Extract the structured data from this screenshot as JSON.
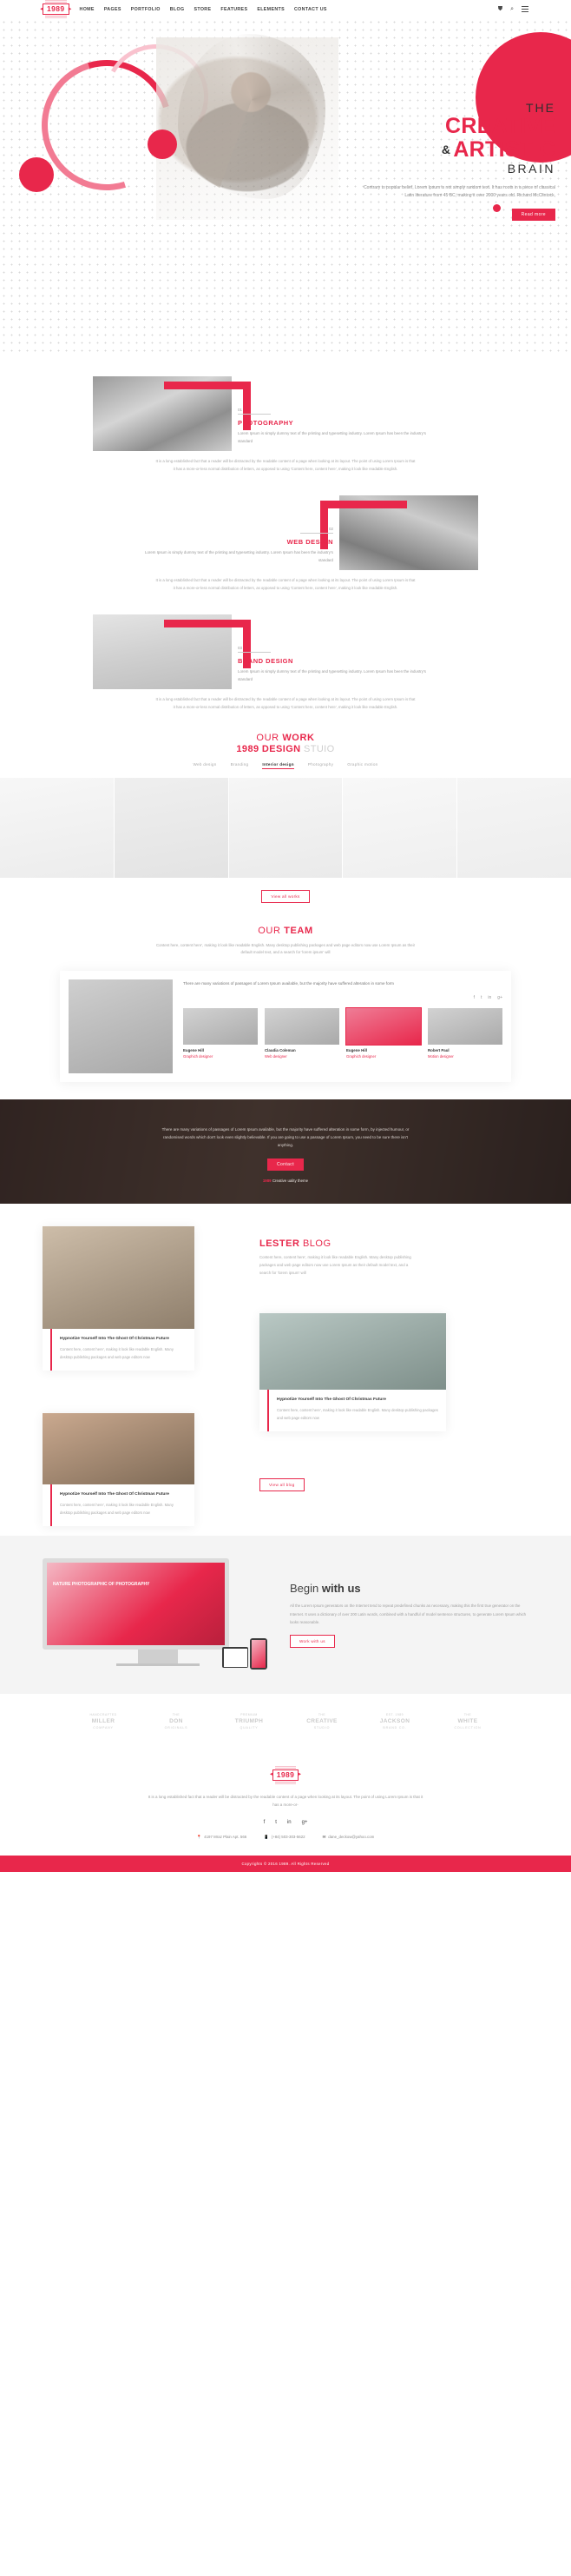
{
  "header": {
    "logo": "1989",
    "nav": [
      {
        "label": "HOME"
      },
      {
        "label": "PAGES"
      },
      {
        "label": "PORTFOLIO"
      },
      {
        "label": "BLOG"
      },
      {
        "label": "STORE"
      },
      {
        "label": "FEATURES"
      },
      {
        "label": "ELEMENTS"
      },
      {
        "label": "CONTACT US"
      }
    ],
    "icons": {
      "cart": "cart-icon",
      "search": "search-icon",
      "menu": "hamburger-icon"
    }
  },
  "hero": {
    "eyebrow": "THE",
    "line1": "CREATIVE",
    "amp": "&",
    "line2": "ARTISTIC",
    "line3": "BRAIN",
    "paragraph": "Contrary to popular belief, Lorem Ipsum is not simply random text. It has roots in a piece of classical Latin literature from 45 BC, making it over 2000 years old. Richard McClintock,",
    "button": "Read more"
  },
  "services": [
    {
      "number": "01",
      "title": "PHOTOGRAPHY",
      "desc": "Lorem Ipsum is simply dummy text of the printing and typesetting industry. Lorem Ipsum has been the industry's standard",
      "desc2": "It is a long established fact that a reader will be distracted by the readable content of a page when looking at its layout. The point of using Lorem Ipsum is that it has a more-or-less normal distribution of letters, as opposed to using 'Content here, content here', making it look like readable English."
    },
    {
      "number": "02",
      "title": "WEB DESIGN",
      "desc": "Lorem Ipsum is simply dummy text of the printing and typesetting industry. Lorem Ipsum has been the industry's standard",
      "desc2": "It is a long established fact that a reader will be distracted by the readable content of a page when looking at its layout. The point of using Lorem Ipsum is that it has a more-or-less normal distribution of letters, as opposed to using 'Content here, content here', making it look like readable English."
    },
    {
      "number": "03",
      "title": "BRAND DESIGN",
      "desc": "Lorem Ipsum is simply dummy text of the printing and typesetting industry. Lorem Ipsum has been the industry's standard",
      "desc2": "It is a long established fact that a reader will be distracted by the readable content of a page when looking at its layout. The point of using Lorem Ipsum is that it has a more-or-less normal distribution of letters, as opposed to using 'Content here, content here', making it look like readable English."
    }
  ],
  "work": {
    "title_light": "OUR ",
    "title_bold": "WORK",
    "subtitle_bold": "1989 DESIGN",
    "subtitle_light": " STUIO",
    "filters": [
      {
        "label": "Web design",
        "active": false
      },
      {
        "label": "Branding",
        "active": false
      },
      {
        "label": "Interior design",
        "active": true
      },
      {
        "label": "Photography",
        "active": false
      },
      {
        "label": "Graphic motion",
        "active": false
      }
    ],
    "items": [
      {
        "name": "ceramic-cups"
      },
      {
        "name": "vintage-typewriter"
      },
      {
        "name": "kraft-boxes"
      },
      {
        "name": "paper-cup"
      },
      {
        "name": "orange-juice-tote-bag"
      }
    ],
    "button": "View all works"
  },
  "team": {
    "title_light": "OUR ",
    "title_bold": "TEAM",
    "subtitle": "Content here, content here', making it look like readable English. Many desktop publishing packages and web page editors now use Lorem Ipsum as their default model text, and a search for 'lorem ipsum' will",
    "quote": "There are many variations of passages of Lorem Ipsum available, but the majority have suffered alteration in some form",
    "social": [
      "f",
      "t",
      "in",
      "g+"
    ],
    "members": [
      {
        "name": "Eugene Hill",
        "role": "Graphich designer",
        "active": false
      },
      {
        "name": "Claudia Coleman",
        "role": "Web designer",
        "active": false
      },
      {
        "name": "Eugene Hill",
        "role": "Graphich designer",
        "active": true
      },
      {
        "name": "Robert Paul",
        "role": "Motion designer",
        "active": false
      }
    ]
  },
  "cta": {
    "paragraph": "There are many variations of passages of Lorem Ipsum available, but the majority have suffered alteration in some form, by injected humour, or randomised words which don't look even slightly believable. If you are going to use a passage of Lorem Ipsum, you need to be sure there isn't anything.",
    "button": "Contact",
    "signature_bold": "1989",
    "signature_light": "Creative uality theme"
  },
  "blog": {
    "title_bold": "LESTER ",
    "title_light": "BLOG",
    "intro": "Content here, content here', making it look like readable English. Many desktop publishing packages and web page editors now use Lorem Ipsum as their default model text, and a search for 'lorem ipsum' will",
    "posts": [
      {
        "title": "Hypnotize Yourself Into The Ghost Of Christmas Future",
        "excerpt": "Content here, content here', making it look like readable English. Many desktop publishing packages and web page editors now"
      },
      {
        "title": "Hypnotize Yourself Into The Ghost Of Christmas Future",
        "excerpt": "Content here, content here', making it look like readable English. Many desktop publishing packages and web page editors now"
      },
      {
        "title": "Hypnotize Yourself Into The Ghost Of Christmas Future",
        "excerpt": "Content here, content here', making it look like readable English. Many desktop publishing packages and web page editors now"
      }
    ],
    "button": "View all blog"
  },
  "begin": {
    "screen_label": "NATURE\nPHOTOGRAPHIC\nOF PHOTOGRAPHY",
    "title_light": "Begin ",
    "title_bold": "with us",
    "paragraph": "All the Lorem Ipsum generators on the Internet tend to repeat predefined chunks as necessary, making this the first true generator on the Internet. It uses a dictionary of over 200 Latin words, combined with a handful of model sentence structures, to generate Lorem Ipsum which looks reasonable.",
    "button": "Work with us"
  },
  "brands": [
    {
      "top": "HANDCRAFTED",
      "name": "MILLER",
      "sub": "COMPANY"
    },
    {
      "top": "THE",
      "name": "DON",
      "sub": "ORIGINALS"
    },
    {
      "top": "PREMIUM",
      "name": "TRIUMPH",
      "sub": "QUALITY"
    },
    {
      "top": "THE",
      "name": "CREATIVE",
      "sub": "STUDIO"
    },
    {
      "top": "EST. 1989",
      "name": "JACKSON",
      "sub": "BRAND CO."
    },
    {
      "top": "THE",
      "name": "WHITE",
      "sub": "COLLECTION"
    }
  ],
  "footer": {
    "logo": "1989",
    "paragraph": "It is a long established fact that a reader will be distracted by the readable content of a page when looking at its layout. The point of using Lorem Ipsum is that it has a more-or-",
    "social": [
      "f",
      "t",
      "in",
      "g+"
    ],
    "address": "4197 Mraz Plain Apt. 566",
    "phone": "(+84) 503-303-5622",
    "email": "dane_deckow@yahoo.com",
    "copyright": "Copyrights © 2016 1989. All Rights Reserved"
  },
  "colors": {
    "accent": "#e8274b",
    "dark": "#3a3a3a",
    "muted": "#a0a0a0"
  }
}
